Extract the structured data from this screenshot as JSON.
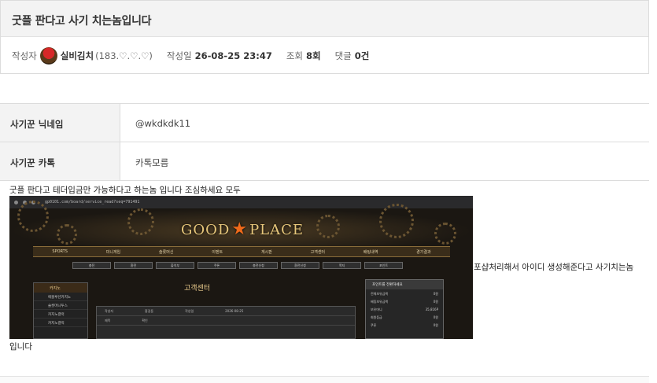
{
  "post": {
    "title": "굿플 판다고 사기 치는놈입니다",
    "author_label": "작성자",
    "author_name": "실비김치",
    "author_level": "(183.♡.♡.♡)",
    "date_label": "작성일",
    "date_value": "26-08-25 23:47",
    "views_label": "조회",
    "views_value": "8회",
    "comments_label": "댓글",
    "comments_value": "0건"
  },
  "info": [
    {
      "key": "사기꾼 닉네임",
      "value": "@wkdkdk11"
    },
    {
      "key": "사기꾼 카톡",
      "value": "카톡모름"
    }
  ],
  "body": {
    "line1": "굿플 판다고 테더입금만 가능하다고 하는놈 입니다 조심하세요 모두",
    "line2": "포샵처리해서 아이디 생성해준다고 사기치는놈",
    "line3": "입니다"
  },
  "screenshot": {
    "url": "gp0101.com/board/service_read?seq=791491",
    "logo_left": "GOOD",
    "logo_right": "PLACE",
    "nav": [
      "SPORTS",
      "미니게임",
      "슬롯머신",
      "이벤트",
      "게시판",
      "고객센터",
      "배팅내역",
      "경기결과"
    ],
    "sub_nav": [
      "충전",
      "환전",
      "출석부",
      "쿠폰",
      "충전신청",
      "환전신청",
      "쪽지",
      "포인트"
    ],
    "sidebar_title": "카지노",
    "sidebar_items": [
      "에볼루션카지노",
      "슬롯머니투스",
      "카지노갤럭",
      "카지노갤럭"
    ],
    "center_title": "고객센터",
    "center_rows": [
      [
        "작성자",
        "홍길동",
        "작성일",
        "2026-08-25"
      ],
      [
        "제목",
        "확인"
      ]
    ],
    "right_title": "포인트를 전환하세요",
    "right_rows": [
      [
        "전체보유금액",
        "0원"
      ],
      [
        "배팅보유금액",
        "0원"
      ],
      [
        "보유머니",
        "35,816P"
      ],
      [
        "회원등급",
        "0원"
      ],
      [
        "쿠폰",
        "0원"
      ]
    ]
  }
}
